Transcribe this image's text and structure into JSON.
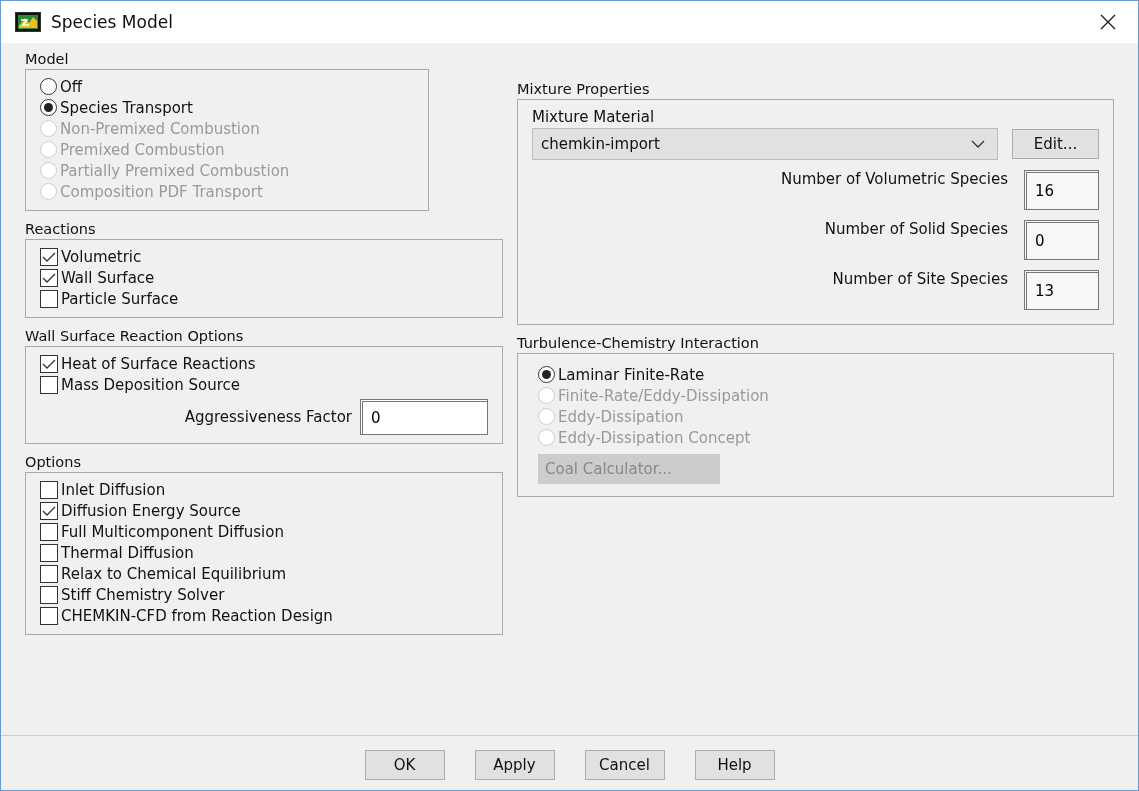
{
  "window": {
    "title": "Species Model"
  },
  "model": {
    "label": "Model",
    "options": [
      {
        "label": "Off",
        "selected": false,
        "disabled": false
      },
      {
        "label": "Species Transport",
        "selected": true,
        "disabled": false
      },
      {
        "label": "Non-Premixed Combustion",
        "selected": false,
        "disabled": true
      },
      {
        "label": "Premixed Combustion",
        "selected": false,
        "disabled": true
      },
      {
        "label": "Partially Premixed Combustion",
        "selected": false,
        "disabled": true
      },
      {
        "label": "Composition PDF Transport",
        "selected": false,
        "disabled": true
      }
    ]
  },
  "reactions": {
    "label": "Reactions",
    "options": [
      {
        "label": "Volumetric",
        "checked": true
      },
      {
        "label": "Wall Surface",
        "checked": true
      },
      {
        "label": "Particle Surface",
        "checked": false
      }
    ]
  },
  "wall_surface_reaction_options": {
    "label": "Wall Surface Reaction Options",
    "options": [
      {
        "label": "Heat of Surface Reactions",
        "checked": true
      },
      {
        "label": "Mass Deposition Source",
        "checked": false
      }
    ],
    "aggressiveness_factor": {
      "label": "Aggressiveness Factor",
      "value": "0"
    }
  },
  "options": {
    "label": "Options",
    "options": [
      {
        "label": "Inlet Diffusion",
        "checked": false
      },
      {
        "label": "Diffusion Energy Source",
        "checked": true
      },
      {
        "label": "Full Multicomponent Diffusion",
        "checked": false
      },
      {
        "label": "Thermal Diffusion",
        "checked": false
      },
      {
        "label": "Relax to Chemical Equilibrium",
        "checked": false
      },
      {
        "label": "Stiff Chemistry Solver",
        "checked": false
      },
      {
        "label": "CHEMKIN-CFD from Reaction Design",
        "checked": false
      }
    ]
  },
  "mixture_properties": {
    "label": "Mixture Properties",
    "material_label": "Mixture Material",
    "material": "chemkin-import",
    "edit_button": "Edit...",
    "fields": [
      {
        "label": "Number of Volumetric Species",
        "value": "16"
      },
      {
        "label": "Number of Solid Species",
        "value": "0"
      },
      {
        "label": "Number of Site Species",
        "value": "13"
      }
    ]
  },
  "turbulence_chemistry_interaction": {
    "label": "Turbulence-Chemistry Interaction",
    "options": [
      {
        "label": "Laminar Finite-Rate",
        "selected": true,
        "disabled": false
      },
      {
        "label": "Finite-Rate/Eddy-Dissipation",
        "selected": false,
        "disabled": true
      },
      {
        "label": "Eddy-Dissipation",
        "selected": false,
        "disabled": true
      },
      {
        "label": "Eddy-Dissipation Concept",
        "selected": false,
        "disabled": true
      }
    ],
    "coal_calculator": {
      "label": "Coal Calculator...",
      "disabled": true
    }
  },
  "buttons": [
    "OK",
    "Apply",
    "Cancel",
    "Help"
  ]
}
